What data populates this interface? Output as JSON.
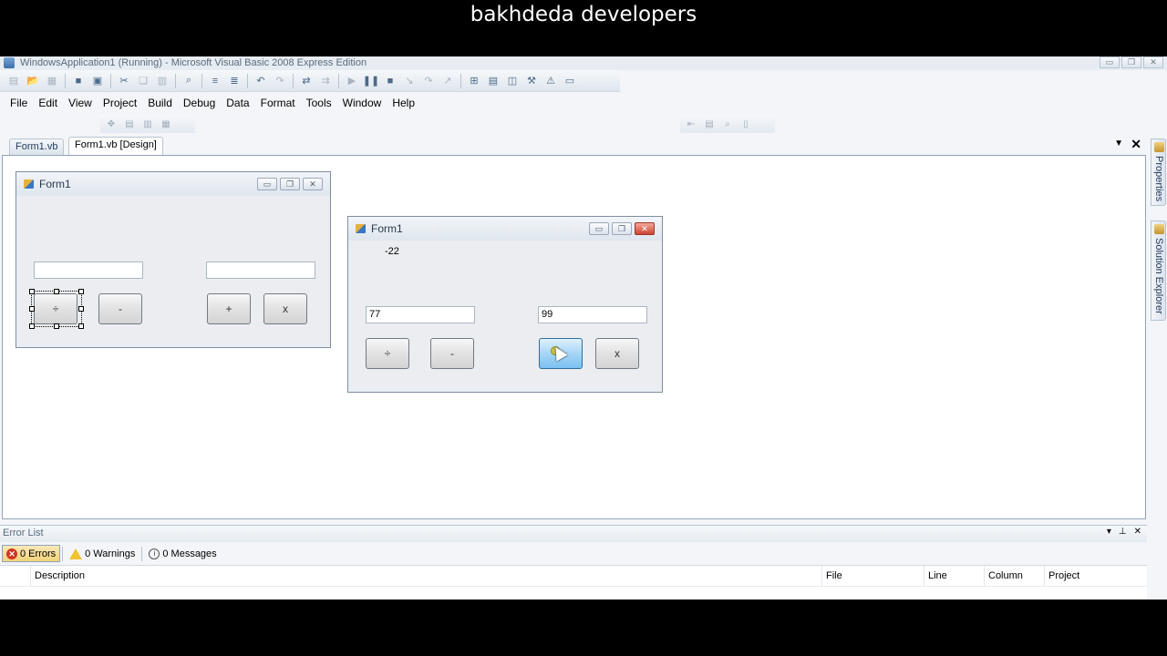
{
  "banner": {
    "text": "bakhdeda developers"
  },
  "app": {
    "title": "WindowsApplication1 (Running) - Microsoft Visual Basic 2008 Express Edition",
    "controls": [
      "▭",
      "❐",
      "✕"
    ]
  },
  "toolbar": {
    "icons": [
      "new-project-icon",
      "open-icon",
      "add-item-icon",
      "save-icon",
      "save-all-icon",
      "cut-icon",
      "copy-icon",
      "paste-icon",
      "find-icon",
      "comment-icon",
      "uncomment-icon",
      "undo-icon",
      "redo-icon",
      "navigate-icon",
      "start-icon",
      "pause-icon",
      "stop-icon",
      "step-into-icon",
      "step-over-icon",
      "step-out-icon",
      "solution-explorer-icon",
      "properties-icon",
      "object-browser-icon",
      "toolbox-icon",
      "error-list-icon"
    ]
  },
  "menu": {
    "items": [
      "File",
      "Edit",
      "View",
      "Project",
      "Build",
      "Debug",
      "Data",
      "Format",
      "Tools",
      "Window",
      "Help"
    ]
  },
  "tabs": [
    {
      "label": "Form1.vb"
    },
    {
      "label": "Form1.vb [Design]"
    }
  ],
  "tab_controls": {
    "dropdown": "▼",
    "close": "✕"
  },
  "design_form": {
    "title": "Form1",
    "buttons": [
      "÷",
      "-",
      "+",
      "x"
    ],
    "textbox1": "",
    "textbox2": ""
  },
  "running_form": {
    "title": "Form1",
    "result_label": "-22",
    "textbox1": "77",
    "textbox2": "99",
    "buttons": [
      "÷",
      "-",
      "+",
      "x"
    ]
  },
  "side_panels": [
    {
      "label": "Properties"
    },
    {
      "label": "Solution Explorer"
    }
  ],
  "error_list": {
    "title": "Error List",
    "errors_label": "0 Errors",
    "warnings_label": "0 Warnings",
    "messages_label": "0 Messages",
    "columns": [
      "Description",
      "File",
      "Line",
      "Column",
      "Project"
    ],
    "header_controls": [
      "▾",
      "⊥",
      "✕"
    ]
  }
}
